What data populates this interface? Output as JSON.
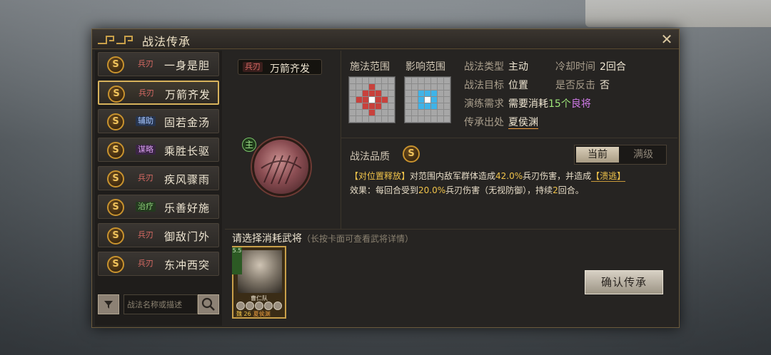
{
  "window": {
    "title": "战法传承"
  },
  "skills": [
    {
      "grade": "S",
      "type": "兵刃",
      "name": "一身是胆"
    },
    {
      "grade": "S",
      "type": "兵刃",
      "name": "万箭齐发"
    },
    {
      "grade": "S",
      "type": "辅助",
      "name": "固若金汤"
    },
    {
      "grade": "S",
      "type": "谋略",
      "name": "乘胜长驱"
    },
    {
      "grade": "S",
      "type": "兵刃",
      "name": "疾风骤雨"
    },
    {
      "grade": "S",
      "type": "治疗",
      "name": "乐善好施"
    },
    {
      "grade": "S",
      "type": "兵刃",
      "name": "御敌门外"
    },
    {
      "grade": "S",
      "type": "兵刃",
      "name": "东冲西突"
    }
  ],
  "search": {
    "placeholder": "战法名称或描述"
  },
  "selected": {
    "type": "兵刃",
    "name": "万箭齐发",
    "main_badge": "主",
    "range_label": "施法范围",
    "effect_label": "影响范围",
    "rows": {
      "type_label": "战法类型",
      "type_value": "主动",
      "cooldown_label": "冷却时间",
      "cooldown_value": "2回合",
      "target_label": "战法目标",
      "target_value": "位置",
      "counter_label": "是否反击",
      "counter_value": "否",
      "req_label": "演练需求",
      "req_prefix": "需要消耗",
      "req_count": "15个",
      "req_item": "良将",
      "source_label": "传承出处",
      "source_value": "夏侯渊"
    },
    "quality_label": "战法品质",
    "quality_value": "S",
    "tabs": {
      "current": "当前",
      "max": "满级"
    },
    "desc": {
      "tag1": "【对位置释放】",
      "t1": "对范围内敌军群体造成",
      "pct1": "42.0%",
      "t2": "兵刃伤害，并造成",
      "tag2": "【溃逃】",
      "t3": "效果：每回合受到",
      "pct2": "20.0%",
      "t4": "兵刃伤害（无视防御），持续",
      "turns": "2",
      "t5": "回合。"
    }
  },
  "bottom": {
    "label": "请选择消耗武将",
    "hint": "（长按卡面可查看武将详情）",
    "card": {
      "name": "曹仁队",
      "level": "26",
      "general": "夏侯渊",
      "cost": "5.5",
      "side": "魏"
    },
    "confirm": "确认传承"
  }
}
